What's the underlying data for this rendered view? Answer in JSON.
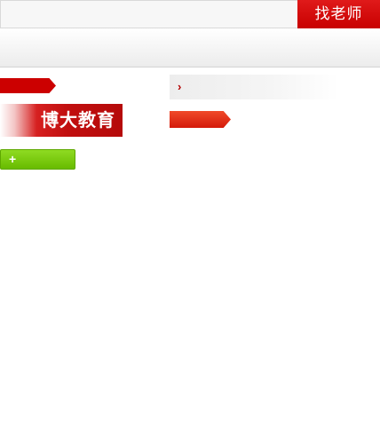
{
  "search": {
    "placeholder": "",
    "value": "",
    "button_label": "找老师"
  },
  "logo": {
    "text": "博大教育"
  },
  "add_button": {
    "icon_glyph": "+"
  },
  "list_item": {
    "icon_glyph": "›"
  },
  "colors": {
    "brand_red": "#cc0000",
    "add_green": "#7cc40f",
    "ribbon_red": "#e3321a"
  }
}
